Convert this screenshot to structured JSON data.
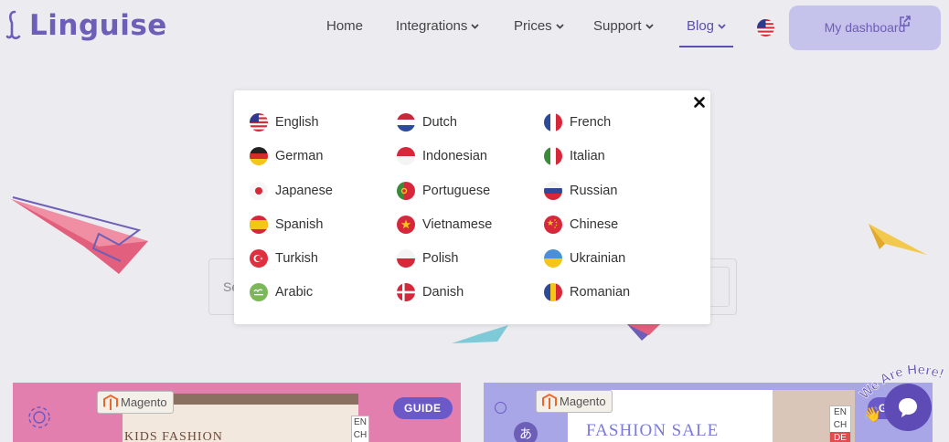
{
  "header": {
    "logo_text": "Linguise",
    "nav": [
      {
        "label": "Home",
        "has_dropdown": false
      },
      {
        "label": "Integrations",
        "has_dropdown": true
      },
      {
        "label": "Prices",
        "has_dropdown": true
      },
      {
        "label": "Support",
        "has_dropdown": true
      },
      {
        "label": "Blog",
        "has_dropdown": true,
        "active": true
      }
    ],
    "current_language_flag": "us-flag-icon",
    "dashboard_button": "My dashboard"
  },
  "search": {
    "placeholder_visible": "Se"
  },
  "language_modal": {
    "close_icon": "close-icon",
    "languages": [
      {
        "label": "English",
        "flag": "us-flag-icon"
      },
      {
        "label": "Dutch",
        "flag": "nl-flag-icon"
      },
      {
        "label": "French",
        "flag": "fr-flag-icon"
      },
      {
        "label": "German",
        "flag": "de-flag-icon"
      },
      {
        "label": "Indonesian",
        "flag": "id-flag-icon"
      },
      {
        "label": "Italian",
        "flag": "it-flag-icon"
      },
      {
        "label": "Japanese",
        "flag": "jp-flag-icon"
      },
      {
        "label": "Portuguese",
        "flag": "pt-flag-icon"
      },
      {
        "label": "Russian",
        "flag": "ru-flag-icon"
      },
      {
        "label": "Spanish",
        "flag": "es-flag-icon"
      },
      {
        "label": "Vietnamese",
        "flag": "vn-flag-icon"
      },
      {
        "label": "Chinese",
        "flag": "cn-flag-icon"
      },
      {
        "label": "Turkish",
        "flag": "tr-flag-icon"
      },
      {
        "label": "Polish",
        "flag": "pl-flag-icon"
      },
      {
        "label": "Ukrainian",
        "flag": "ua-flag-icon"
      },
      {
        "label": "Arabic",
        "flag": "ar-flag-icon"
      },
      {
        "label": "Danish",
        "flag": "dk-flag-icon"
      },
      {
        "label": "Romanian",
        "flag": "ro-flag-icon"
      }
    ]
  },
  "cards": [
    {
      "badge": "GUIDE",
      "platform_tag": "Magento",
      "preview_title": "KIDS FASHION",
      "lang_options": [
        "EN",
        "CH"
      ]
    },
    {
      "badge": "GUIDE",
      "platform_tag": "Magento",
      "preview_title": "FASHION SALE",
      "lang_options": [
        "EN",
        "CH",
        "DE"
      ]
    }
  ],
  "chat": {
    "tagline": "We Are Here!",
    "icon": "chat-bubble-icon"
  },
  "colors": {
    "brand": "#6d5eb7",
    "active_nav": "#5b4fb0",
    "dashboard_bg": "#c5c2ec",
    "page_bg": "#ecebef",
    "card_left_bg": "#e27fae",
    "card_right_bg": "#a9a6e8",
    "badge_bg": "#6c59c8"
  }
}
